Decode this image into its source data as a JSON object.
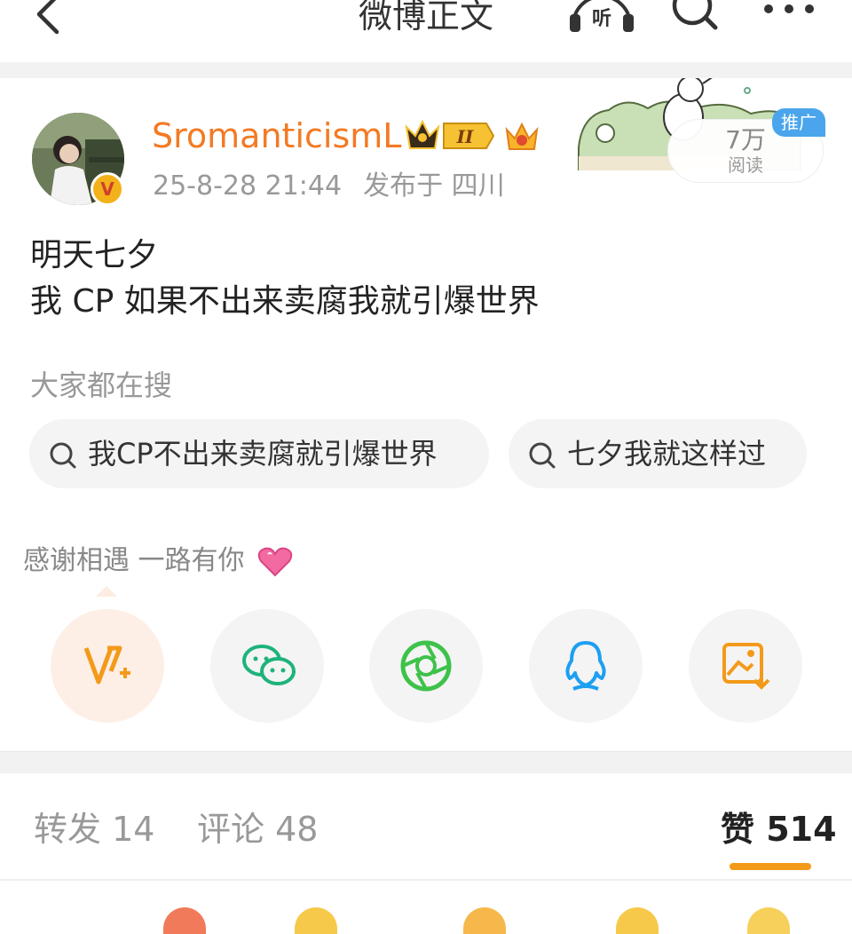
{
  "header": {
    "title": "微博正文",
    "listen_label": "听"
  },
  "post": {
    "username": "SromanticismL",
    "badge_level": "II",
    "timestamp": "25-8-28 21:44",
    "location": "发布于 四川",
    "reads_count": "7万",
    "reads_label": "阅读",
    "promo_tag": "推广",
    "content_lines": [
      "明天七夕",
      "我 CP 如果不出来卖腐我就引爆世界"
    ]
  },
  "hot_search": {
    "title": "大家都在搜",
    "chips": [
      "我CP不出来卖腐就引爆世界",
      "七夕我就这样过"
    ]
  },
  "thanks_text": "感谢相遇 一路有你",
  "share_targets": [
    "weibo-vip",
    "wechat",
    "moments",
    "qq",
    "save-image"
  ],
  "tabs": {
    "repost": "转发 14",
    "comment": "评论 48",
    "like": "赞 514"
  },
  "colors": {
    "accent": "#f37a24",
    "underline": "#f39a1a",
    "promo": "#4aa5ec"
  }
}
